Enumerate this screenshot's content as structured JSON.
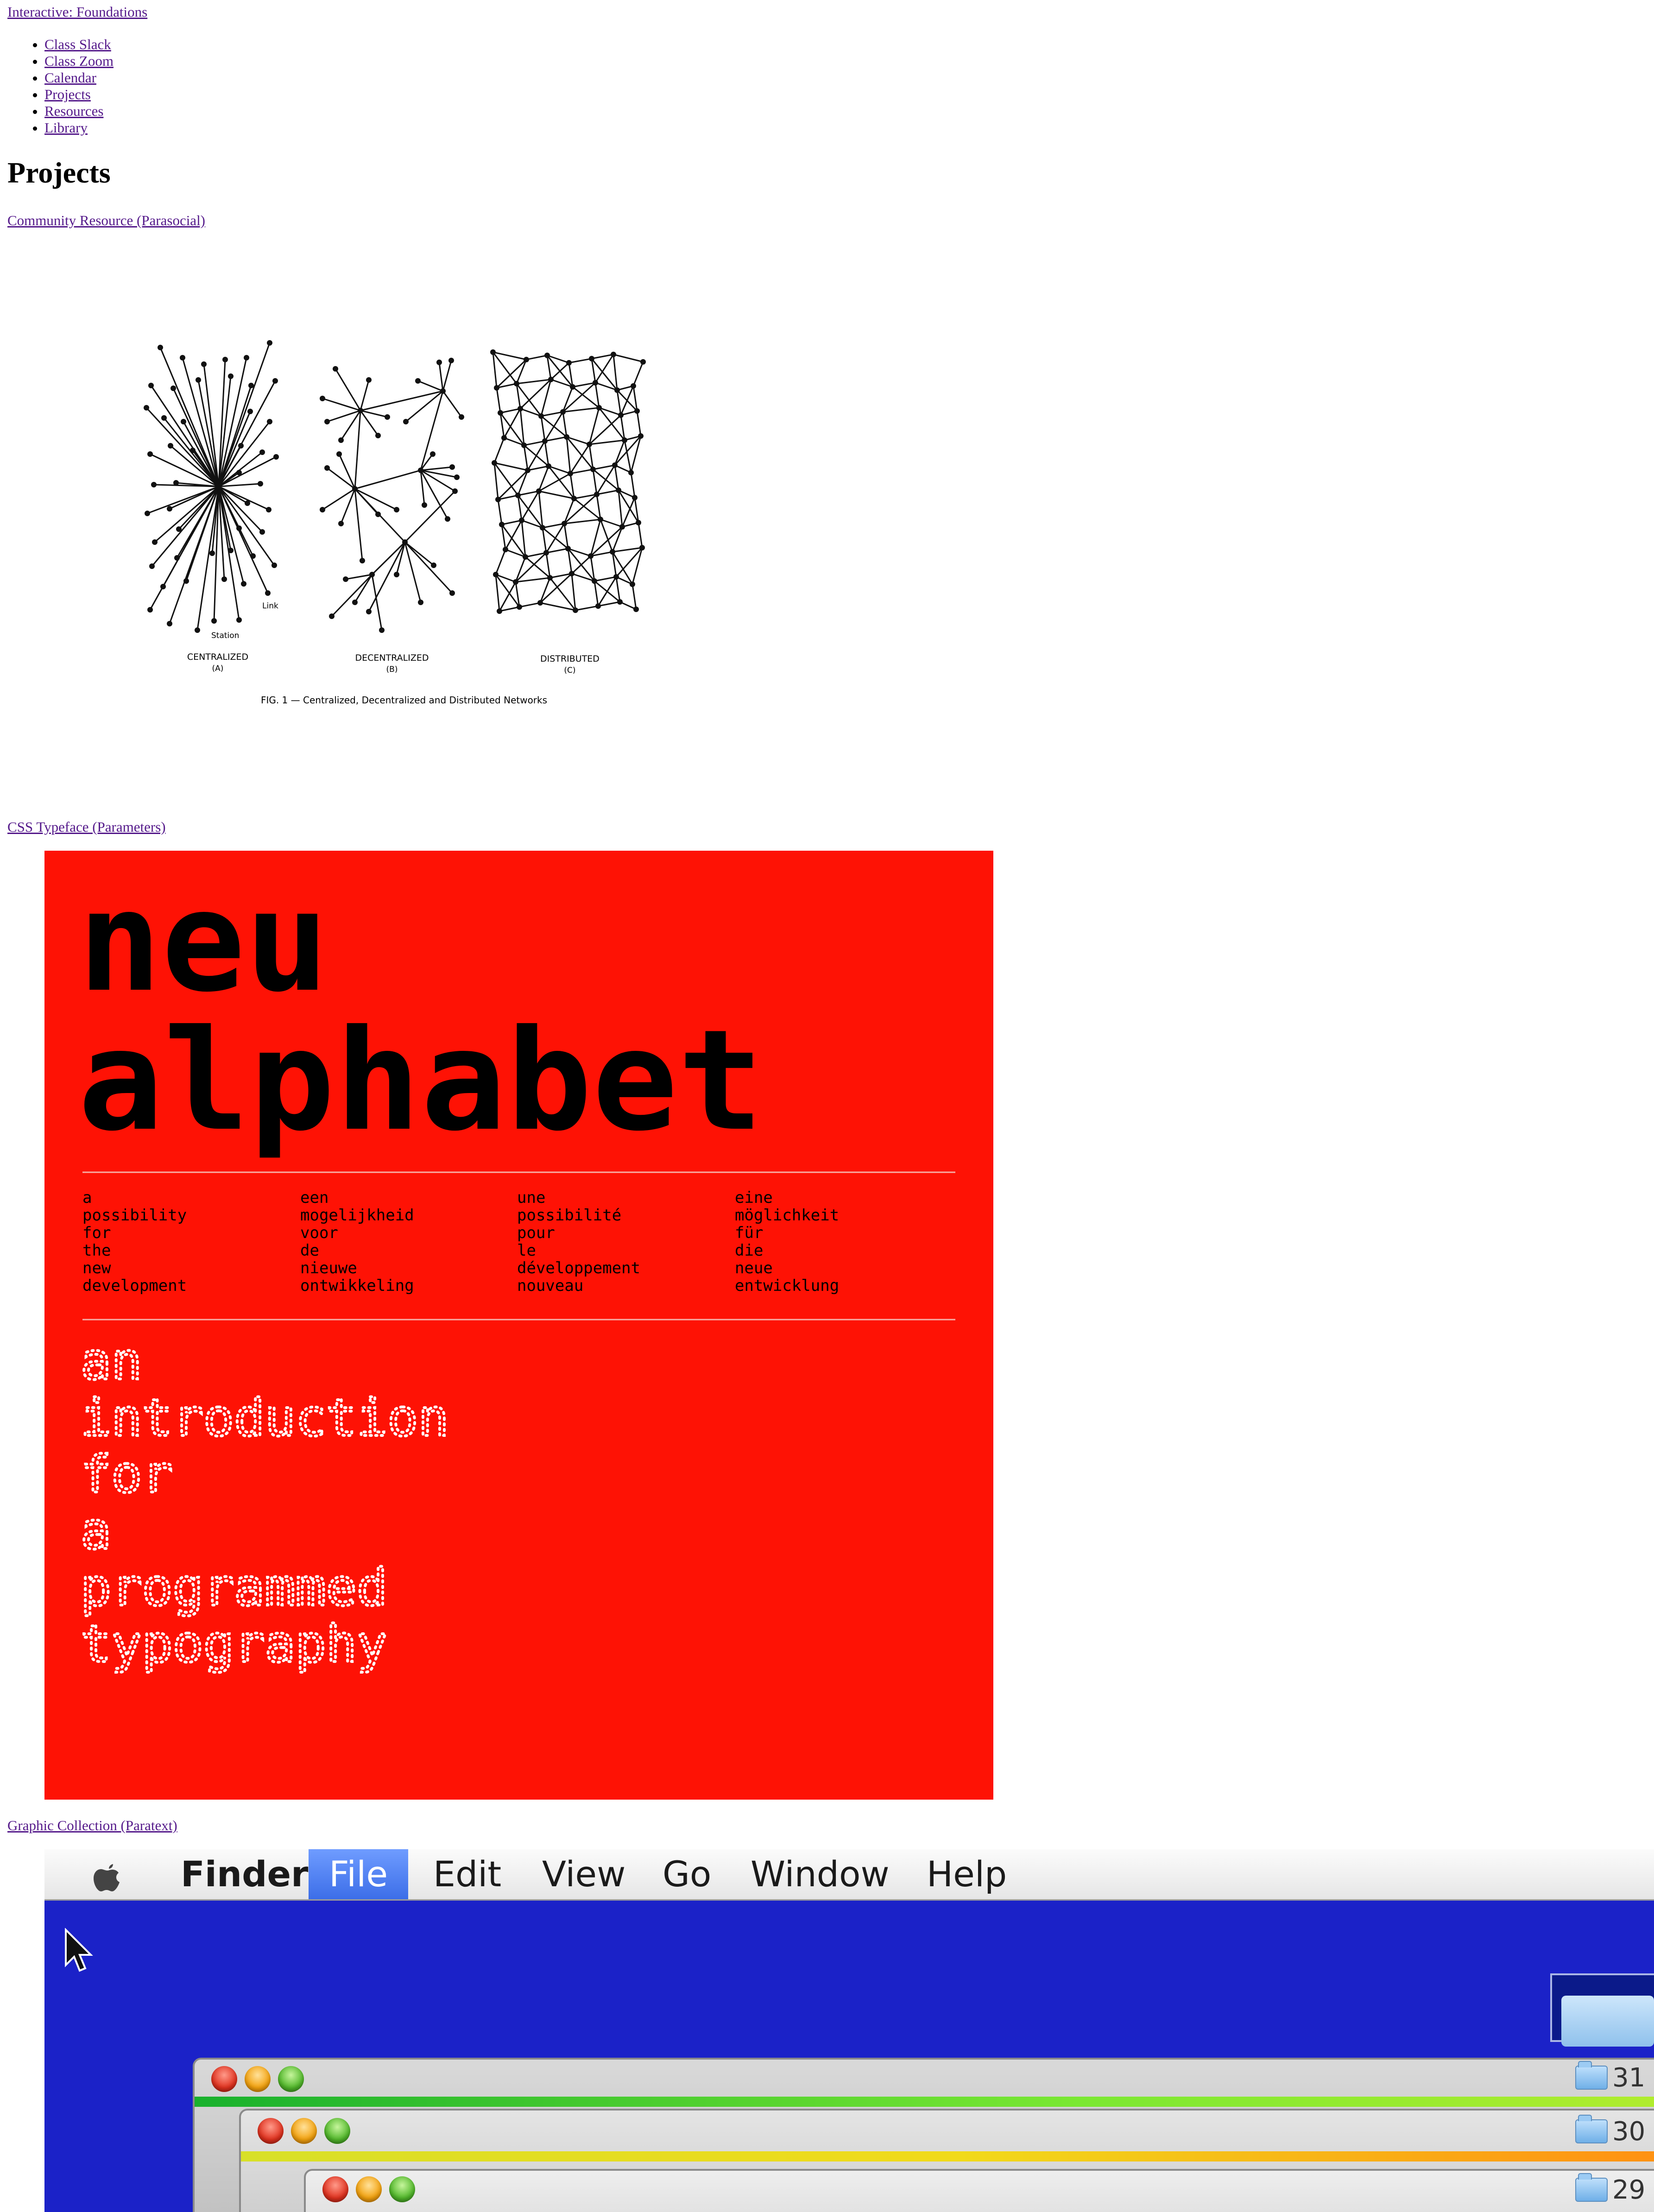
{
  "site": {
    "title": "Interactive: Foundations"
  },
  "nav": {
    "items": [
      {
        "label": "Class Slack"
      },
      {
        "label": "Class Zoom"
      },
      {
        "label": "Calendar"
      },
      {
        "label": "Projects"
      },
      {
        "label": "Resources"
      },
      {
        "label": "Library"
      }
    ]
  },
  "page": {
    "title": "Projects"
  },
  "projects": [
    {
      "link": "Community Resource (Parasocial)",
      "figure": {
        "caption": "FIG. 1 — Centralized, Decentralized and Distributed Networks",
        "labels": {
          "centralized": "CENTRALIZED",
          "centralized_letter": "(A)",
          "decentralized": "DECENTRALIZED",
          "decentralized_letter": "(B)",
          "distributed": "DISTRIBUTED",
          "distributed_letter": "(C)",
          "link": "Link",
          "station": "Station"
        }
      }
    },
    {
      "link": "CSS Typeface (Parameters)",
      "poster": {
        "headline_1": "neu",
        "headline_2": "alphabet",
        "columns": [
          [
            "a",
            "possibility",
            "for",
            "the",
            "new",
            "development"
          ],
          [
            "een",
            "mogelijkheid",
            "voor",
            "de",
            "nieuwe",
            "ontwikkeling"
          ],
          [
            "une",
            "possibilité",
            "pour",
            "le",
            "développement",
            "nouveau"
          ],
          [
            "eine",
            "möglichkeit",
            "für",
            "die",
            "neue",
            "entwicklung"
          ]
        ],
        "dotted_lines": [
          "an",
          "introduction",
          "for",
          "a",
          "programmed",
          "typography"
        ],
        "background": "#fe1205"
      }
    },
    {
      "link": "Graphic Collection (Paratext)",
      "finder": {
        "menu": [
          "Finder",
          "File",
          "Edit",
          "View",
          "Go",
          "Window",
          "Help"
        ],
        "active_menu": "File",
        "folders": [
          "31",
          "30",
          "29"
        ]
      }
    }
  ]
}
